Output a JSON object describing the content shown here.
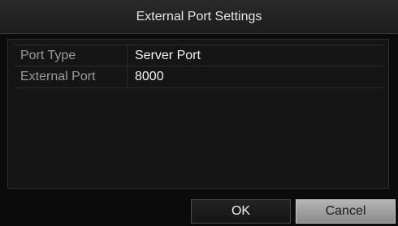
{
  "dialog": {
    "title": "External Port Settings"
  },
  "fields": [
    {
      "label": "Port Type",
      "value": "Server Port"
    },
    {
      "label": "External Port",
      "value": "8000"
    }
  ],
  "buttons": {
    "ok_label": "OK",
    "cancel_label": "Cancel"
  },
  "colors": {
    "background": "#0b0b0b",
    "title_bar": "#222222",
    "label_text": "#9a9a9a",
    "value_text": "#f2f2f2",
    "cancel_button": "#a0a0a0"
  }
}
